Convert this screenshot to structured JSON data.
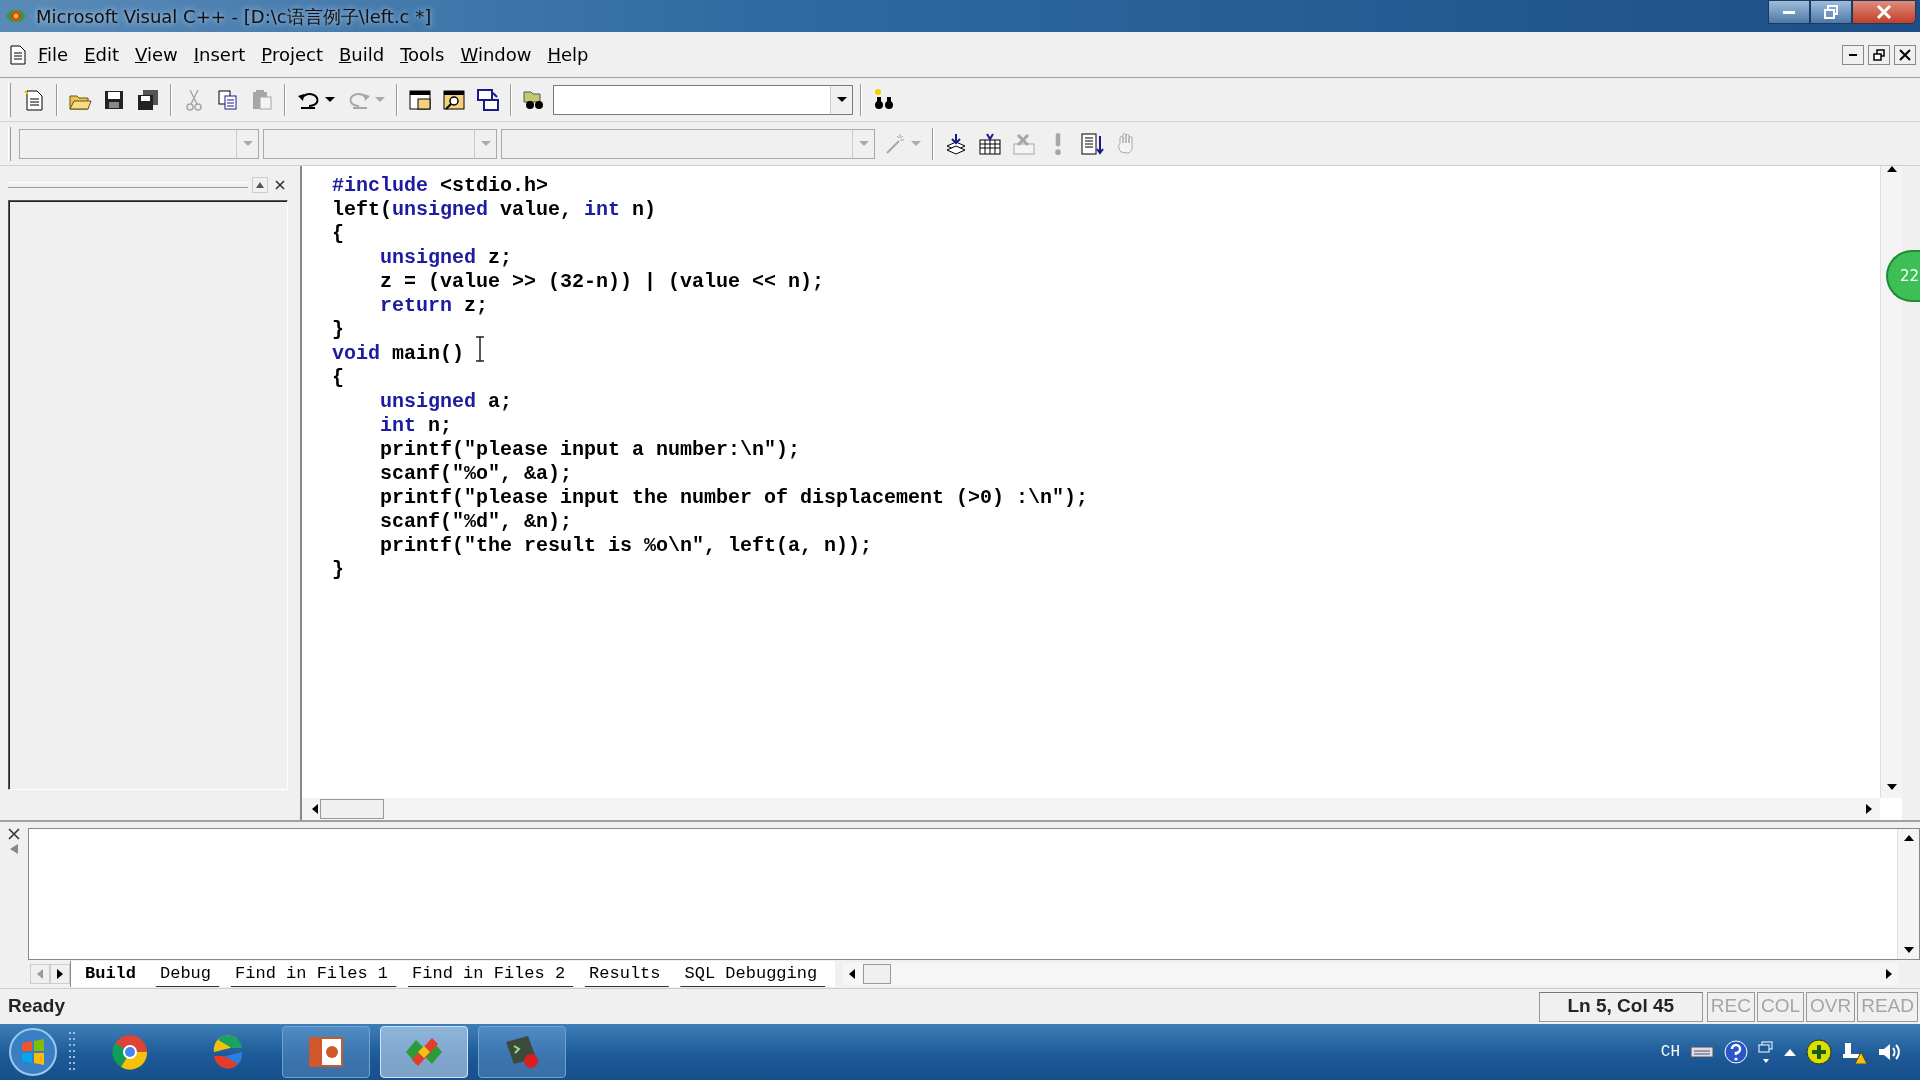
{
  "window": {
    "title": "Microsoft Visual C++ - [D:\\c语言例子\\left.c *]"
  },
  "menu": [
    "File",
    "Edit",
    "View",
    "Insert",
    "Project",
    "Build",
    "Tools",
    "Window",
    "Help"
  ],
  "toolbar_standard": [
    {
      "kind": "new",
      "disabled": false
    },
    {
      "kind": "sep"
    },
    {
      "kind": "open",
      "disabled": false
    },
    {
      "kind": "save",
      "disabled": false
    },
    {
      "kind": "save-all",
      "disabled": false
    },
    {
      "kind": "sep"
    },
    {
      "kind": "cut",
      "disabled": true
    },
    {
      "kind": "copy",
      "disabled": false
    },
    {
      "kind": "paste",
      "disabled": true
    },
    {
      "kind": "sep"
    },
    {
      "kind": "undo",
      "disabled": false
    },
    {
      "kind": "redo",
      "disabled": true
    },
    {
      "kind": "sep"
    },
    {
      "kind": "workspace",
      "disabled": false
    },
    {
      "kind": "output",
      "disabled": false
    },
    {
      "kind": "windows",
      "disabled": false
    },
    {
      "kind": "sep"
    },
    {
      "kind": "find-files",
      "disabled": false
    },
    {
      "kind": "combo",
      "disabled": false
    },
    {
      "kind": "sep"
    },
    {
      "kind": "find",
      "disabled": false
    }
  ],
  "toolbar_wizard": [
    {
      "kind": "combo",
      "disabled": true
    },
    {
      "kind": "combo",
      "disabled": true
    },
    {
      "kind": "combo",
      "disabled": true
    },
    {
      "kind": "wand",
      "disabled": true
    },
    {
      "kind": "sep"
    },
    {
      "kind": "compile",
      "disabled": false
    },
    {
      "kind": "build",
      "disabled": false
    },
    {
      "kind": "stop",
      "disabled": true
    },
    {
      "kind": "execute",
      "disabled": true
    },
    {
      "kind": "go",
      "disabled": false
    },
    {
      "kind": "hand",
      "disabled": true
    }
  ],
  "editor": {
    "lines": [
      [
        {
          "kind": "keyword",
          "text": "#include"
        },
        {
          "kind": "plain",
          "text": " <stdio.h>"
        }
      ],
      [
        {
          "kind": "plain",
          "text": "left("
        },
        {
          "kind": "keyword",
          "text": "unsigned"
        },
        {
          "kind": "plain",
          "text": " value, "
        },
        {
          "kind": "keyword",
          "text": "int"
        },
        {
          "kind": "plain",
          "text": " n)"
        }
      ],
      [
        {
          "kind": "plain",
          "text": "{"
        }
      ],
      [
        {
          "kind": "indent"
        },
        {
          "kind": "keyword",
          "text": "unsigned"
        },
        {
          "kind": "plain",
          "text": " z;"
        }
      ],
      [
        {
          "kind": "indent"
        },
        {
          "kind": "plain",
          "text": "z = (value >> (32-n)) | (value << n);"
        }
      ],
      [
        {
          "kind": "indent"
        },
        {
          "kind": "keyword",
          "text": "return"
        },
        {
          "kind": "plain",
          "text": " z;"
        }
      ],
      [
        {
          "kind": "plain",
          "text": "}"
        }
      ],
      [
        {
          "kind": "keyword",
          "text": "void"
        },
        {
          "kind": "plain",
          "text": " main()"
        }
      ],
      [
        {
          "kind": "plain",
          "text": "{"
        }
      ],
      [
        {
          "kind": "indent"
        },
        {
          "kind": "keyword",
          "text": "unsigned"
        },
        {
          "kind": "plain",
          "text": " a;"
        }
      ],
      [
        {
          "kind": "indent"
        },
        {
          "kind": "keyword",
          "text": "int"
        },
        {
          "kind": "plain",
          "text": " n;"
        }
      ],
      [
        {
          "kind": "indent"
        },
        {
          "kind": "plain",
          "text": "printf(\"please input a number:\\n\");"
        }
      ],
      [
        {
          "kind": "indent"
        },
        {
          "kind": "plain",
          "text": "scanf(\"%o\", &a);"
        }
      ],
      [
        {
          "kind": "indent"
        },
        {
          "kind": "plain",
          "text": "printf(\"please input the number of displacement (>0) :\\n\");"
        }
      ],
      [
        {
          "kind": "indent"
        },
        {
          "kind": "plain",
          "text": "scanf(\"%d\", &n);"
        }
      ],
      [
        {
          "kind": "indent"
        },
        {
          "kind": "plain",
          "text": "printf(\"the result is %o\\n\", left(a, n));"
        }
      ],
      [
        {
          "kind": "plain",
          "text": "}"
        }
      ]
    ]
  },
  "output": {
    "tabs": [
      {
        "label": "Build",
        "selected": true
      },
      {
        "label": "Debug",
        "selected": false
      },
      {
        "label": "Find in Files 1",
        "selected": false
      },
      {
        "label": "Find in Files 2",
        "selected": false
      },
      {
        "label": "Results",
        "selected": false
      },
      {
        "label": "SQL Debugging",
        "selected": false
      }
    ]
  },
  "status_bar": {
    "message": "Ready",
    "position": "Ln 5, Col 45",
    "indicators": [
      {
        "label": "REC",
        "disabled": true
      },
      {
        "label": "COL",
        "disabled": true
      },
      {
        "label": "OVR",
        "disabled": true
      },
      {
        "label": "READ",
        "disabled": true
      }
    ]
  },
  "overlay_badge": {
    "text": "22"
  },
  "taskbar": {
    "apps": [
      {
        "kind": "browser",
        "active": false
      },
      {
        "kind": "swirl",
        "active": false
      },
      {
        "kind": "presentation",
        "active": false
      },
      {
        "kind": "vc",
        "active": true
      },
      {
        "kind": "terminal",
        "active": false
      }
    ],
    "language": "CH"
  }
}
